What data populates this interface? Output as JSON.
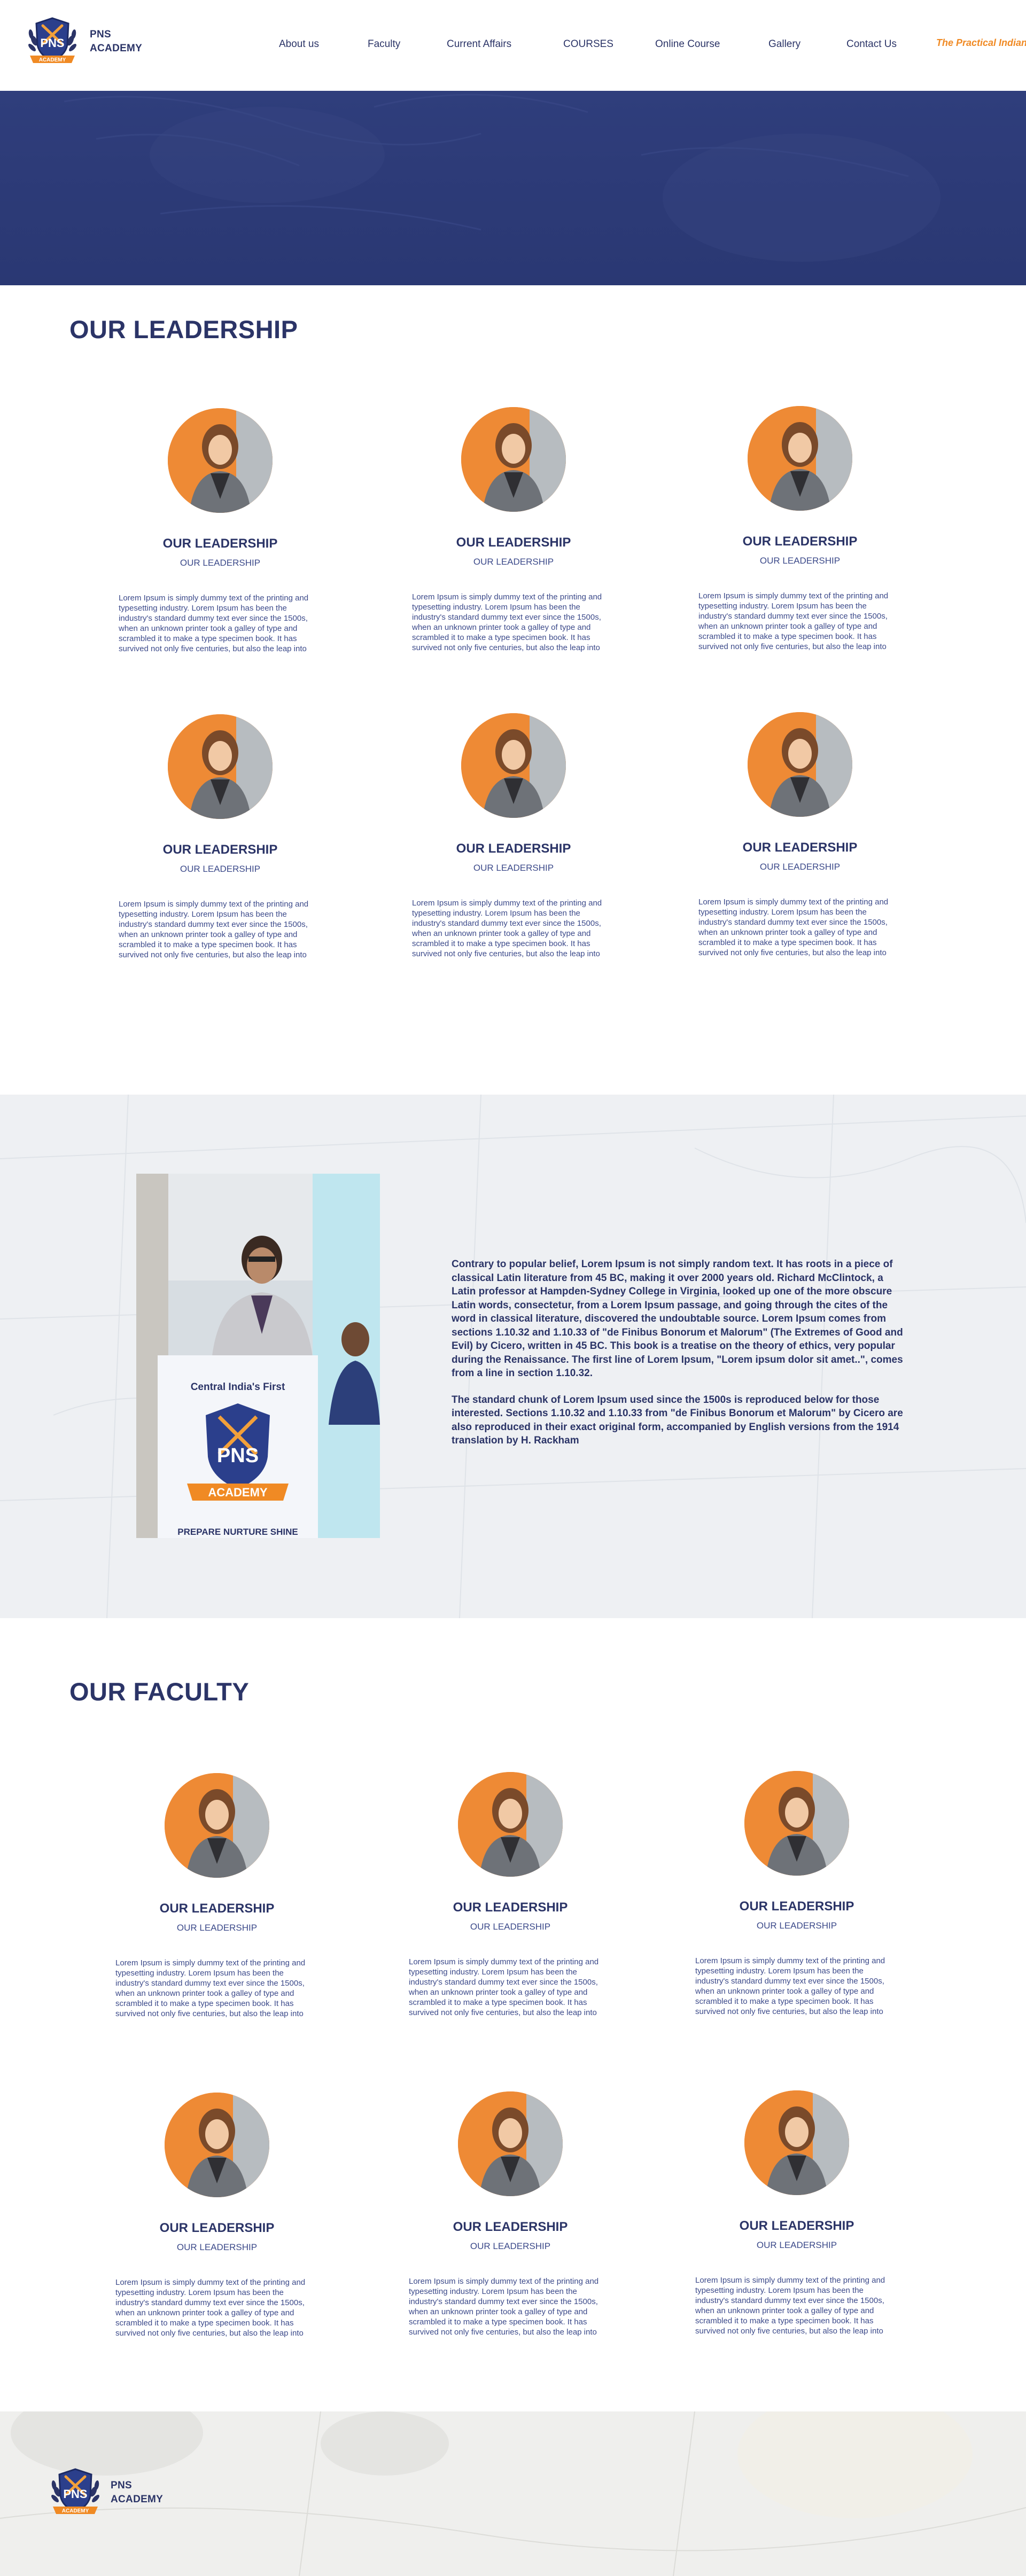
{
  "brand": {
    "name_line1": "PNS",
    "name_line2": "ACADEMY",
    "badge_text": "PNS",
    "badge_ribbon": "ACADEMY"
  },
  "nav": {
    "items": [
      {
        "label": "About us"
      },
      {
        "label": "Faculty"
      },
      {
        "label": "Current Affairs"
      },
      {
        "label": "COURSES"
      },
      {
        "label": "Online Course"
      },
      {
        "label": "Gallery"
      },
      {
        "label": "Contact Us"
      }
    ],
    "partner": "The Practical Indian"
  },
  "colors": {
    "primary": "#2b3467",
    "accent": "#f08a24",
    "hero": "#2d3b78"
  },
  "leadership": {
    "title": "OUR LEADERSHIP",
    "cards": [
      {
        "title": "OUR LEADERSHIP",
        "subtitle": "OUR LEADERSHIP",
        "desc": "Lorem Ipsum is simply dummy text of the printing and typesetting industry. Lorem Ipsum has been the industry's standard dummy text ever since the 1500s, when an unknown printer took a galley of type and scrambled it to make a type specimen book. It has survived not only five centuries, but also the leap into"
      },
      {
        "title": "OUR LEADERSHIP",
        "subtitle": "OUR LEADERSHIP",
        "desc": "Lorem Ipsum is simply dummy text of the printing and typesetting industry. Lorem Ipsum has been the industry's standard dummy text ever since the 1500s, when an unknown printer took a galley of type and scrambled it to make a type specimen book. It has survived not only five centuries, but also the leap into"
      },
      {
        "title": "OUR LEADERSHIP",
        "subtitle": "OUR LEADERSHIP",
        "desc": "Lorem Ipsum is simply dummy text of the printing and typesetting industry. Lorem Ipsum has been the industry's standard dummy text ever since the 1500s, when an unknown printer took a galley of type and scrambled it to make a type specimen book. It has survived not only five centuries, but also the leap into"
      },
      {
        "title": "OUR LEADERSHIP",
        "subtitle": "OUR LEADERSHIP",
        "desc": "Lorem Ipsum is simply dummy text of the printing and typesetting industry. Lorem Ipsum has been the industry's standard dummy text ever since the 1500s, when an unknown printer took a galley of type and scrambled it to make a type specimen book. It has survived not only five centuries, but also the leap into"
      },
      {
        "title": "OUR LEADERSHIP",
        "subtitle": "OUR LEADERSHIP",
        "desc": "Lorem Ipsum is simply dummy text of the printing and typesetting industry. Lorem Ipsum has been the industry's standard dummy text ever since the 1500s, when an unknown printer took a galley of type and scrambled it to make a type specimen book. It has survived not only five centuries, but also the leap into"
      },
      {
        "title": "OUR LEADERSHIP",
        "subtitle": "OUR LEADERSHIP",
        "desc": "Lorem Ipsum is simply dummy text of the printing and typesetting industry. Lorem Ipsum has been the industry's standard dummy text ever since the 1500s, when an unknown printer took a galley of type and scrambled it to make a type specimen book. It has survived not only five centuries, but also the leap into"
      }
    ]
  },
  "about": {
    "photo_sign_line1": "Central India's First",
    "photo_sign_pns": "PNS",
    "photo_sign_ribbon": "ACADEMY",
    "photo_sign_tagline": "PREPARE NURTURE SHINE",
    "paragraph1": "Contrary to popular belief, Lorem Ipsum is not simply random text. It has roots in a piece of classical Latin literature from 45 BC, making it over 2000 years old. Richard McClintock, a Latin professor at Hampden-Sydney College in Virginia, looked up one of the more obscure Latin words, consectetur, from a Lorem Ipsum passage, and going through the cites of the word in classical literature, discovered the undoubtable source. Lorem Ipsum comes from sections 1.10.32 and 1.10.33 of \"de Finibus Bonorum et Malorum\" (The Extremes of Good and Evil) by Cicero, written in 45 BC. This book is a treatise on the theory of ethics, very popular during the Renaissance. The first line of Lorem Ipsum, \"Lorem ipsum dolor sit amet..\", comes from a line in section 1.10.32.",
    "paragraph2": "The standard chunk of Lorem Ipsum used since the 1500s is reproduced below for those interested. Sections 1.10.32 and 1.10.33 from \"de Finibus Bonorum et Malorum\" by Cicero are also reproduced in their exact original form, accompanied by English versions from the 1914 translation by H. Rackham"
  },
  "faculty": {
    "title": "OUR FACULTY",
    "cards": [
      {
        "title": "OUR LEADERSHIP",
        "subtitle": "OUR LEADERSHIP",
        "desc": "Lorem Ipsum is simply dummy text of the printing and typesetting industry. Lorem Ipsum has been the industry's standard dummy text ever since the 1500s, when an unknown printer took a galley of type and scrambled it to make a type specimen book. It has survived not only five centuries, but also the leap into"
      },
      {
        "title": "OUR LEADERSHIP",
        "subtitle": "OUR LEADERSHIP",
        "desc": "Lorem Ipsum is simply dummy text of the printing and typesetting industry. Lorem Ipsum has been the industry's standard dummy text ever since the 1500s, when an unknown printer took a galley of type and scrambled it to make a type specimen book. It has survived not only five centuries, but also the leap into"
      },
      {
        "title": "OUR LEADERSHIP",
        "subtitle": "OUR LEADERSHIP",
        "desc": "Lorem Ipsum is simply dummy text of the printing and typesetting industry. Lorem Ipsum has been the industry's standard dummy text ever since the 1500s, when an unknown printer took a galley of type and scrambled it to make a type specimen book. It has survived not only five centuries, but also the leap into"
      },
      {
        "title": "OUR LEADERSHIP",
        "subtitle": "OUR LEADERSHIP",
        "desc": "Lorem Ipsum is simply dummy text of the printing and typesetting industry. Lorem Ipsum has been the industry's standard dummy text ever since the 1500s, when an unknown printer took a galley of type and scrambled it to make a type specimen book. It has survived not only five centuries, but also the leap into"
      },
      {
        "title": "OUR LEADERSHIP",
        "subtitle": "OUR LEADERSHIP",
        "desc": "Lorem Ipsum is simply dummy text of the printing and typesetting industry. Lorem Ipsum has been the industry's standard dummy text ever since the 1500s, when an unknown printer took a galley of type and scrambled it to make a type specimen book. It has survived not only five centuries, but also the leap into"
      },
      {
        "title": "OUR LEADERSHIP",
        "subtitle": "OUR LEADERSHIP",
        "desc": "Lorem Ipsum is simply dummy text of the printing and typesetting industry. Lorem Ipsum has been the industry's standard dummy text ever since the 1500s, when an unknown printer took a galley of type and scrambled it to make a type specimen book. It has survived not only five centuries, but also the leap into"
      }
    ]
  },
  "footer": {
    "name_line1": "PNS",
    "name_line2": "ACADEMY"
  }
}
